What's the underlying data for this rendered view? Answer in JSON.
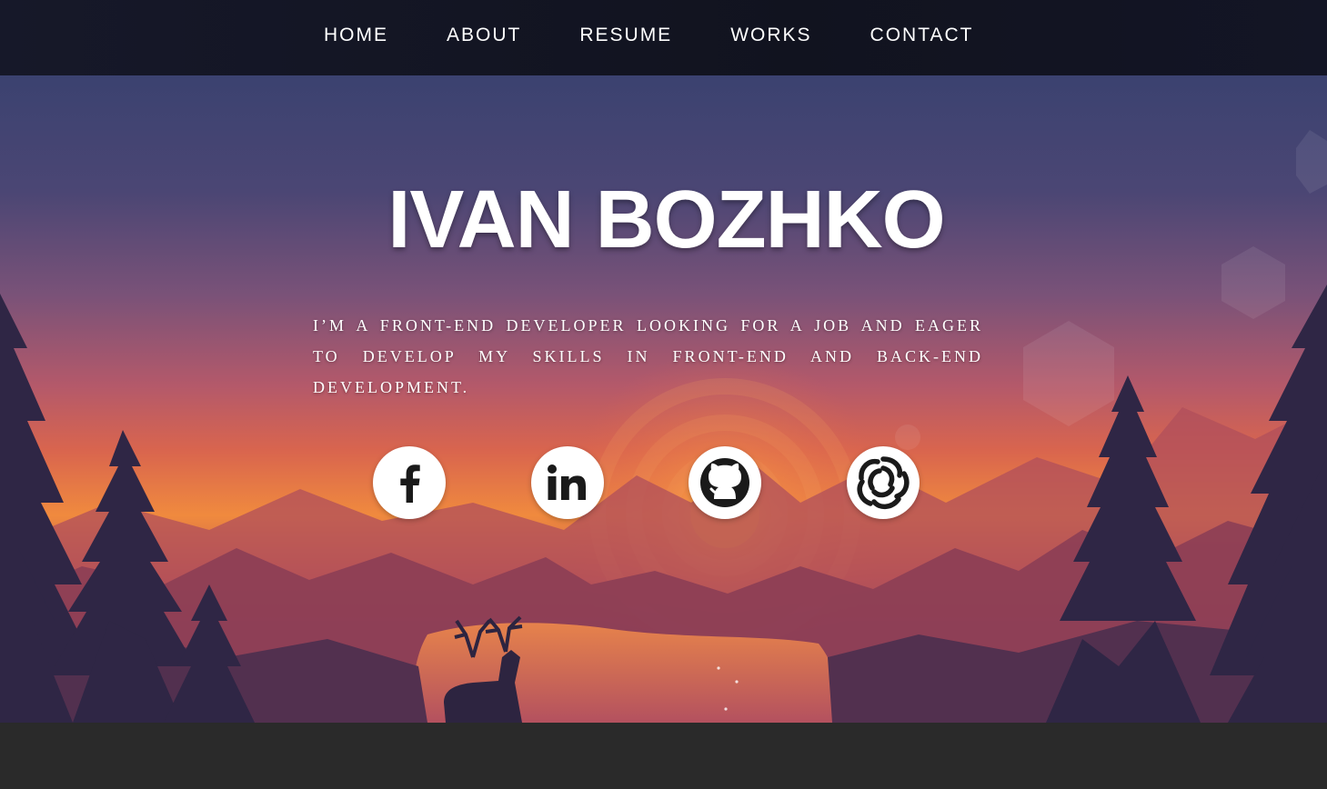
{
  "nav": {
    "items": [
      {
        "label": "HOME"
      },
      {
        "label": "ABOUT"
      },
      {
        "label": "RESUME"
      },
      {
        "label": "WORKS"
      },
      {
        "label": "CONTACT"
      }
    ]
  },
  "hero": {
    "title": "IVAN BOZHKO",
    "tagline": "I’M A FRONT-END DEVELOPER LOOKING FOR A JOB AND EAGER TO DEVELOP MY SKILLS IN FRONT-END AND BACK-END DEVELOPMENT.",
    "background": "firewatch-style sunset landscape with mountains, pine trees, lake and deer"
  },
  "social": [
    {
      "name": "facebook",
      "icon": "facebook-icon"
    },
    {
      "name": "linkedin",
      "icon": "linkedin-icon"
    },
    {
      "name": "github",
      "icon": "github-icon"
    },
    {
      "name": "sololearn",
      "icon": "sololearn-icon"
    }
  ],
  "colors": {
    "nav_bg": "#131525",
    "footer_bg": "#2a2a2a",
    "icon_bg": "#ffffff",
    "icon_fg": "#1a1a1a",
    "sun": "#f79a3c"
  }
}
